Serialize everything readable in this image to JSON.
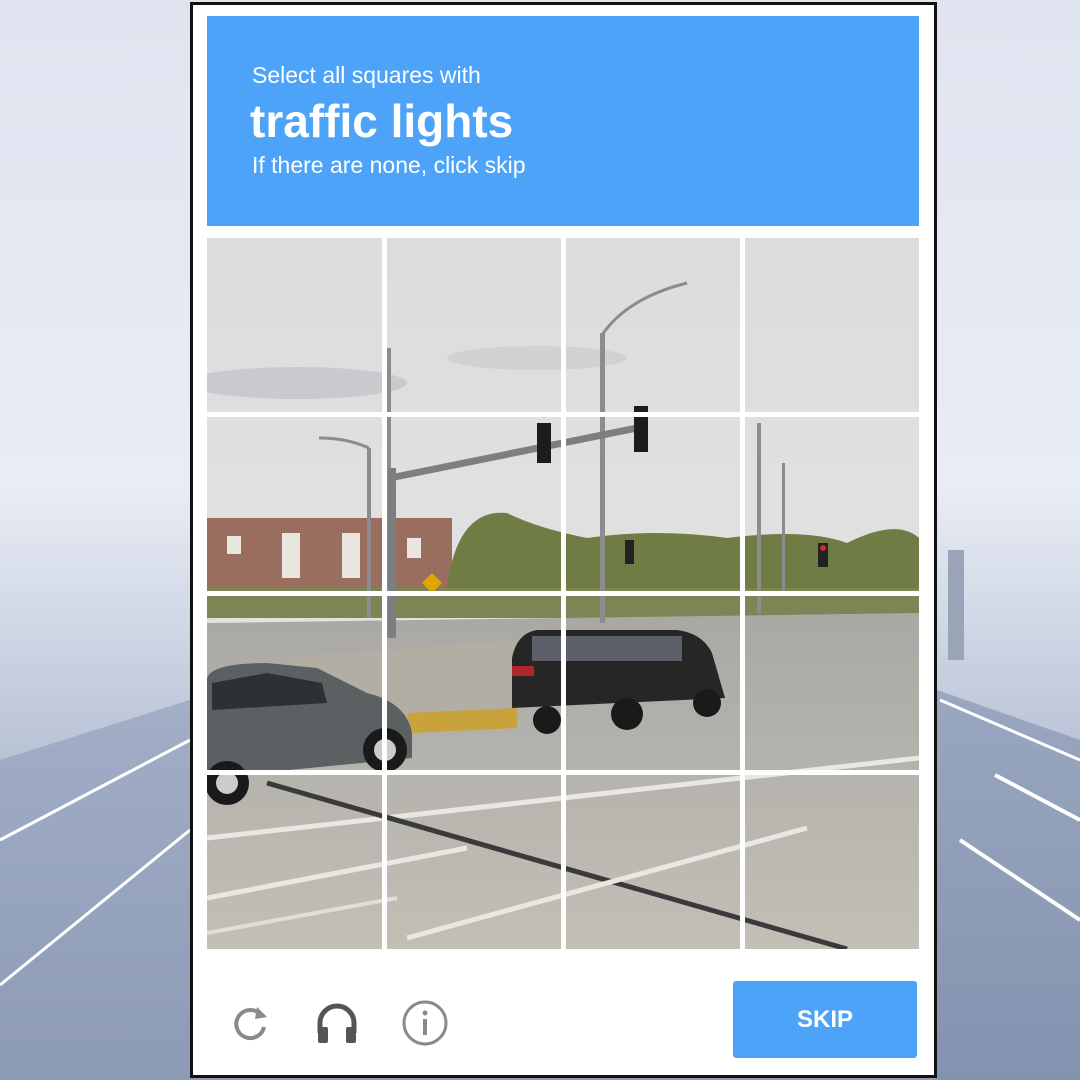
{
  "challenge": {
    "instruction": "Select all squares with",
    "target": "traffic lights",
    "hint": "If there are none, click skip"
  },
  "grid": {
    "rows": 4,
    "columns": 4
  },
  "footer": {
    "icons": [
      "reload-icon",
      "headphones-icon",
      "info-icon"
    ],
    "skip_label": "SKIP"
  },
  "colors": {
    "accent": "#4da3f7",
    "frame_border": "#111111"
  }
}
